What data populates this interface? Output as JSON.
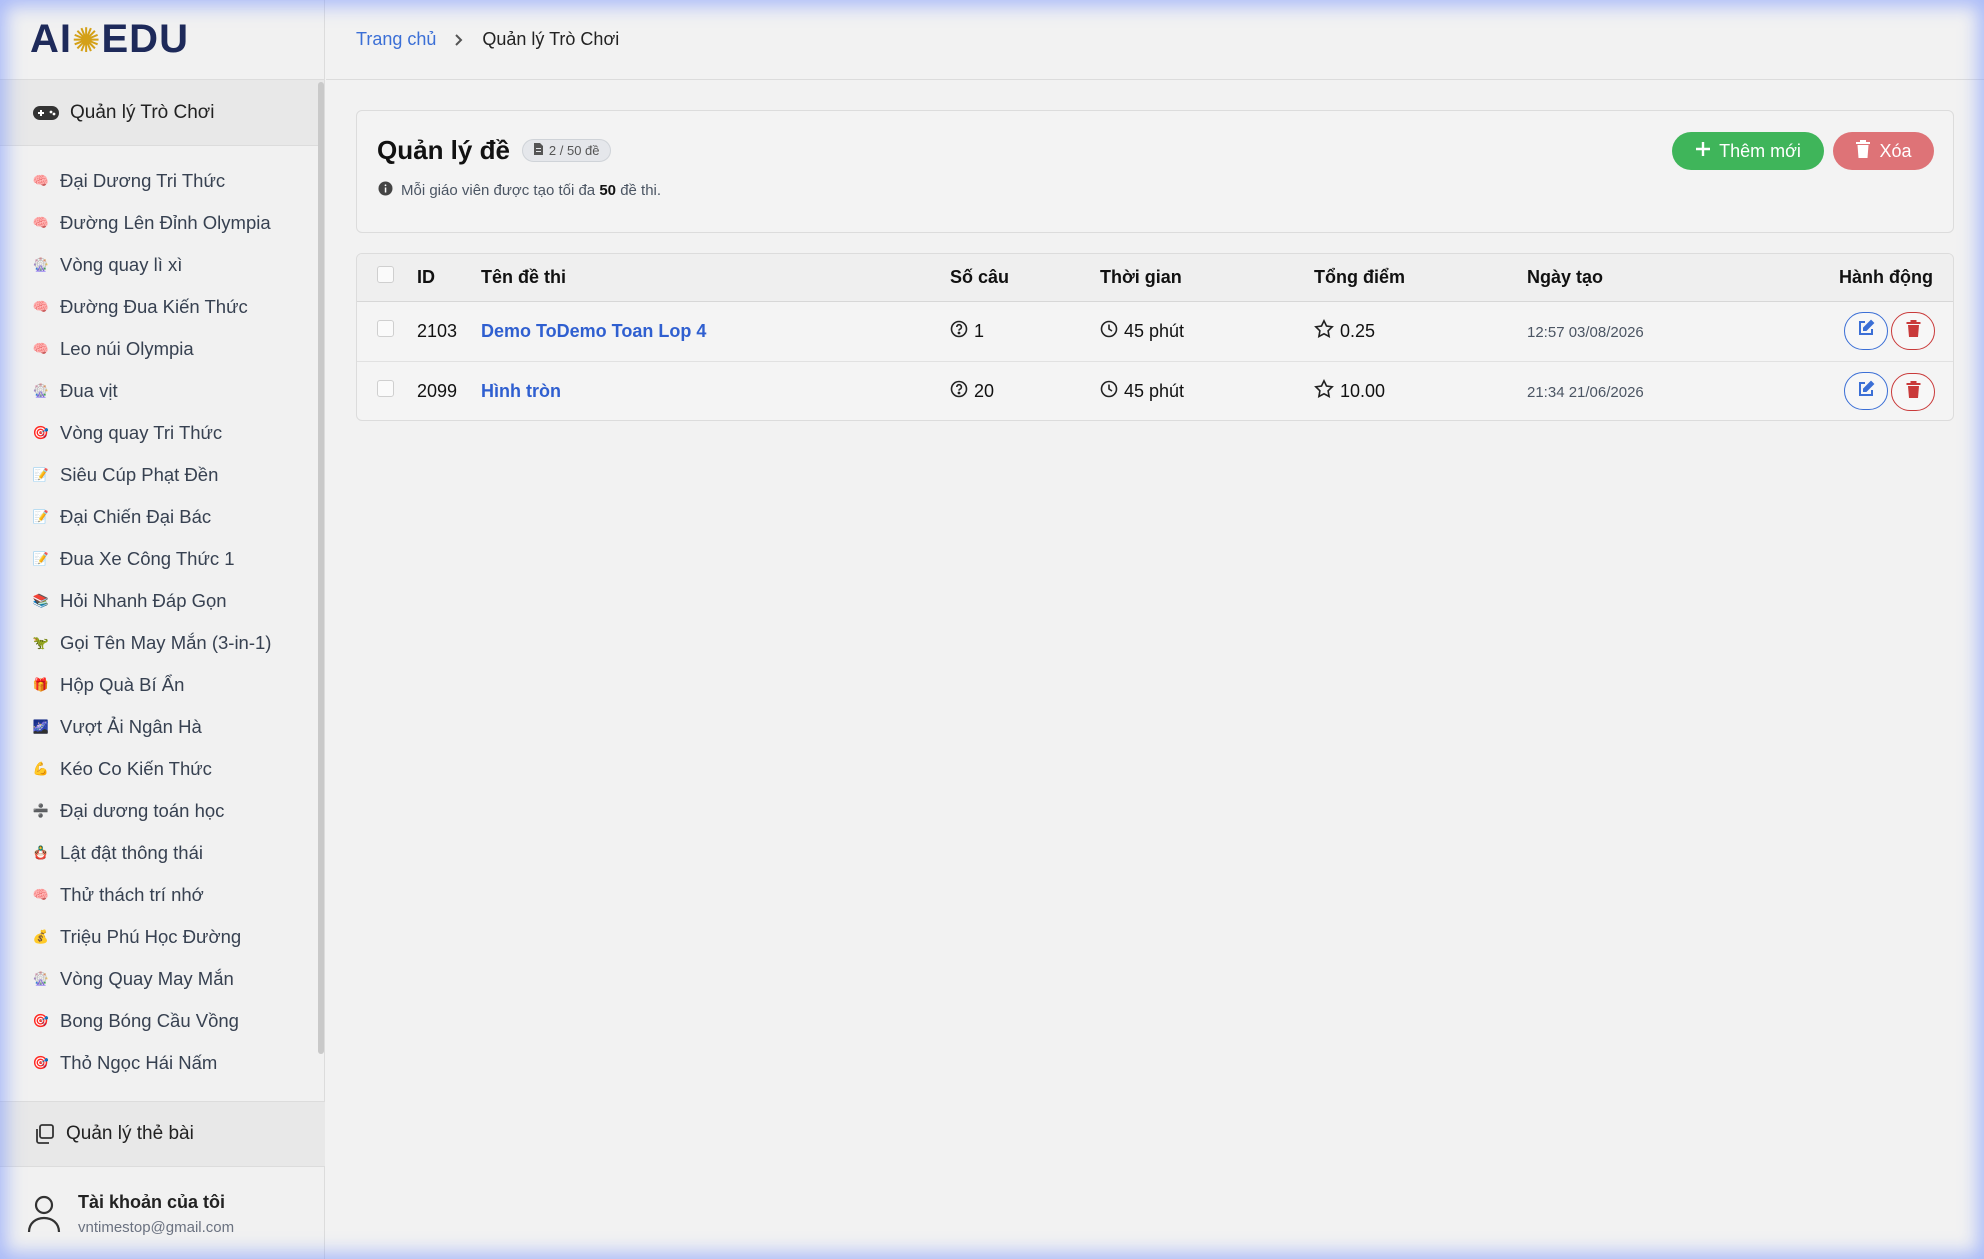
{
  "app": {
    "logo_text_left": "AI",
    "logo_text_right": "EDU"
  },
  "sidebar": {
    "section_title": "Quản lý Trò Chơi",
    "games": [
      {
        "label": "Đại Dương Tri Thức",
        "emoji": "🧠"
      },
      {
        "label": "Đường Lên Đỉnh Olympia",
        "emoji": "🧠"
      },
      {
        "label": "Vòng quay lì xì",
        "emoji": "🎡"
      },
      {
        "label": "Đường Đua Kiến Thức",
        "emoji": "🧠"
      },
      {
        "label": "Leo núi Olympia",
        "emoji": "🧠"
      },
      {
        "label": "Đua vịt",
        "emoji": "🎡"
      },
      {
        "label": "Vòng quay Tri Thức",
        "emoji": "🎯"
      },
      {
        "label": "Siêu Cúp Phạt Đền",
        "emoji": "📝"
      },
      {
        "label": "Đại Chiến Đại Bác",
        "emoji": "📝"
      },
      {
        "label": "Đua Xe Công Thức 1",
        "emoji": "📝"
      },
      {
        "label": "Hỏi Nhanh Đáp Gọn",
        "emoji": "📚"
      },
      {
        "label": "Gọi Tên May Mắn (3-in-1)",
        "emoji": "🦖"
      },
      {
        "label": "Hộp Quà Bí Ẩn",
        "emoji": "🎁"
      },
      {
        "label": "Vượt Ải Ngân Hà",
        "emoji": "🌌"
      },
      {
        "label": "Kéo Co Kiến Thức",
        "emoji": "💪"
      },
      {
        "label": "Đại dương toán học",
        "emoji": "➗"
      },
      {
        "label": "Lật đật thông thái",
        "emoji": "🪆"
      },
      {
        "label": "Thử thách trí nhớ",
        "emoji": "🧠"
      },
      {
        "label": "Triệu Phú Học Đường",
        "emoji": "💰"
      },
      {
        "label": "Vòng Quay May Mắn",
        "emoji": "🎡"
      },
      {
        "label": "Bong Bóng Cầu Vồng",
        "emoji": "🎯"
      },
      {
        "label": "Thỏ Ngọc Hái Nấm",
        "emoji": "🎯"
      }
    ],
    "card_menu": "Quản lý thẻ bài",
    "account": {
      "title": "Tài khoản của tôi",
      "email": "vntimestop@gmail.com"
    }
  },
  "breadcrumb": {
    "home": "Trang chủ",
    "current": "Quản lý Trò Chơi"
  },
  "panel": {
    "title": "Quản lý đề",
    "badge": "2 / 50 đề",
    "note_before": "Mỗi giáo viên được tạo tối đa",
    "note_bold": "50",
    "note_after": "đề thi.",
    "add_label": "Thêm mới",
    "delete_label": "Xóa"
  },
  "table": {
    "headers": {
      "id": "ID",
      "name": "Tên đề thi",
      "questions": "Số câu",
      "time": "Thời gian",
      "score": "Tổng điểm",
      "created": "Ngày tạo",
      "actions": "Hành động"
    },
    "rows": [
      {
        "id": "2103",
        "name": "Demo ToDemo Toan Lop 4",
        "questions": "1",
        "time": "45 phút",
        "score": "0.25",
        "created": "12:57 03/08/2026"
      },
      {
        "id": "2099",
        "name": "Hình tròn",
        "questions": "20",
        "time": "45 phút",
        "score": "10.00",
        "created": "21:34 21/06/2026"
      }
    ]
  },
  "colors": {
    "accent_blue": "#3b6fd6",
    "add_green": "#3fb55a",
    "delete_red": "#de7377"
  }
}
